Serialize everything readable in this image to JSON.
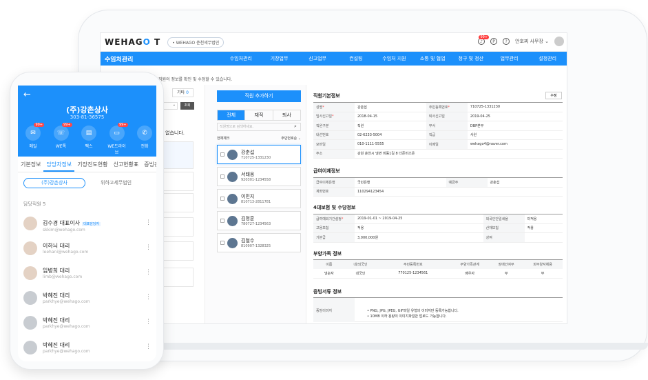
{
  "app": {
    "logo_a": "WEHAG",
    "logo_o": "O",
    "logo_t": "T",
    "company": "• WEHAGO 춘천세무법인",
    "user": "안호찌 사무장 ⌄",
    "notif_count": "99+"
  },
  "nav": {
    "title": "수임처관리",
    "items": [
      "수임처관리",
      "기장업무",
      "신고업무",
      "컨설팅",
      "수임처 지원",
      "소통 및 협업",
      "청구 및 정산",
      "업무관리",
      "설정관리"
    ]
  },
  "hint": "직원의 정보를 확인 및 수정할 수 있습니다.",
  "left": {
    "tab_other": "기타",
    "tab_other_count": "0",
    "search": "조회",
    "empty": "없습니다."
  },
  "staff": {
    "add": "직원 추가하기",
    "seg": [
      "전체",
      "재직",
      "퇴사"
    ],
    "search_ph": "직원명으로 검색하세요.",
    "select_all": "전체체크",
    "sort": "주민번호순 ⌄",
    "list": [
      {
        "name": "강춘섭",
        "rrn": "710725-1331230"
      },
      {
        "name": "서태웅",
        "rrn": "920301-1234558"
      },
      {
        "name": "이민지",
        "rrn": "810713-2811781"
      },
      {
        "name": "김정훈",
        "rrn": "780727-1234563"
      },
      {
        "name": "김철수",
        "rrn": "810907-1328325"
      }
    ]
  },
  "detail": {
    "basic_title": "직원기본정보",
    "edit": "수정",
    "basic": [
      [
        "성명",
        "강춘섭",
        "주민등록번호",
        "710725-1331230"
      ],
      [
        "입사신고일",
        "2018-04-15",
        "퇴사신고일",
        "2019-04-25"
      ],
      [
        "직원구분",
        "직원",
        "부서",
        "DBP본부"
      ],
      [
        "내선번호",
        "02-6233-5004",
        "직급",
        "사원"
      ],
      [
        "모바일",
        "010-1111-5555",
        "이메일",
        "wehago4@naver.com"
      ],
      [
        "주소",
        "강원 춘천시 냉면 비동1길 8 더존비즈온",
        "",
        ""
      ]
    ],
    "pay_title": "급여이체정보",
    "pay": [
      [
        "급여이체은행",
        "국민은행",
        "예금주",
        "강춘섭"
      ],
      [
        "계좌번호",
        "110294123454",
        "",
        ""
      ]
    ],
    "ins_title": "4대보험 및 수당정보",
    "ins": [
      [
        "급여예외기간설정",
        "2019-01-01 ~ 2019-04-25",
        "외국인단일세율",
        "미적용"
      ],
      [
        "고용보험",
        "적용",
        "산재보험",
        "적용"
      ],
      [
        "기본급",
        "3,000,000원",
        "상여",
        ""
      ]
    ],
    "fam_title": "부양가족 정보",
    "fam_head": [
      "이름",
      "내/외국인",
      "주민등록번호",
      "부양가족관계",
      "장애인여부",
      "피부양자체용"
    ],
    "fam_row": [
      "냉순자",
      "내국인",
      "770125-1234561",
      "배우자",
      "부",
      "부"
    ],
    "doc_title": "증빙서류 정보",
    "doc_label": "증빙이미지",
    "doc_notes": [
      "• PNG, JPG, JPEG, GIF파일 유형의 이미지만 등록가능합니다.",
      "• 10MB 이하 용량의 이미지파일만 업로드 가능합니다."
    ]
  },
  "phone": {
    "company": "(주)강촌상사",
    "tel": "303-81-36575",
    "actions": [
      {
        "label": "메일",
        "badge": "99+"
      },
      {
        "label": "WE톡",
        "badge": "99+"
      },
      {
        "label": "팩스",
        "badge": ""
      },
      {
        "label": "WE드라이브",
        "badge": "99+"
      },
      {
        "label": "전화",
        "badge": ""
      }
    ],
    "tabs": [
      "기본정보",
      "담당자정보",
      "기장진도현황",
      "신고현황표",
      "증빙관"
    ],
    "pill": "(주)강촌상사",
    "pill2": "위하고세무법인",
    "count": "담당직원 5",
    "people": [
      {
        "name": "김수경 대표이사",
        "tag": "대표담당자",
        "email": "skkim@wehago.com"
      },
      {
        "name": "이하늬 대리",
        "tag": "",
        "email": "leehani@wehago.com"
      },
      {
        "name": "임병희 대리",
        "tag": "",
        "email": "limb@wehago.com"
      },
      {
        "name": "박혜진 대리",
        "tag": "",
        "email": "parkhye@wehago.com"
      },
      {
        "name": "박혜진 대리",
        "tag": "",
        "email": "parkhye@wehago.com"
      },
      {
        "name": "박혜진 대리",
        "tag": "",
        "email": "parkhye@wehago.com"
      }
    ]
  }
}
